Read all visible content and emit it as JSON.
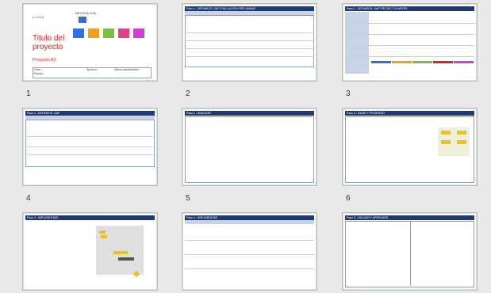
{
  "slides": [
    {
      "num": "1",
      "header": "",
      "cover": {
        "logo": "(LOGO)",
        "title_line1": "Titulo del",
        "title_line2": "proyecto",
        "subtitle": "Proyecto A3",
        "field1": "Líder:",
        "field2": "Equipo:",
        "field3": "Sponsor:",
        "field4": "Última actualización:",
        "diagram_title": "METODOLOGÍA"
      }
    },
    {
      "num": "2",
      "header": "Paso 1 - DEFINIR EL GAP        EVALUACIÓN PRELIMINAR"
    },
    {
      "num": "3",
      "header": "Paso 1 - DEFINIR EL GAP        PROJECT CHARTER"
    },
    {
      "num": "4",
      "header": "Paso 1 - DEFINIR EL GAP"
    },
    {
      "num": "5",
      "header": "Paso 2 - ANALIZAR"
    },
    {
      "num": "6",
      "header": "Paso 3 - IDEAR Y PRIORIZAR"
    },
    {
      "num": "",
      "header": "Paso 4 - IMPLEMENTAR"
    },
    {
      "num": "",
      "header": "Paso 4 - IMPLEMENTAR"
    },
    {
      "num": "",
      "header": "Paso 5 - VALIDAR Y APRENDER"
    }
  ],
  "colors": {
    "header": "#1f3a70",
    "cover_red": "#e02020",
    "bg": "#e9e9e9"
  }
}
